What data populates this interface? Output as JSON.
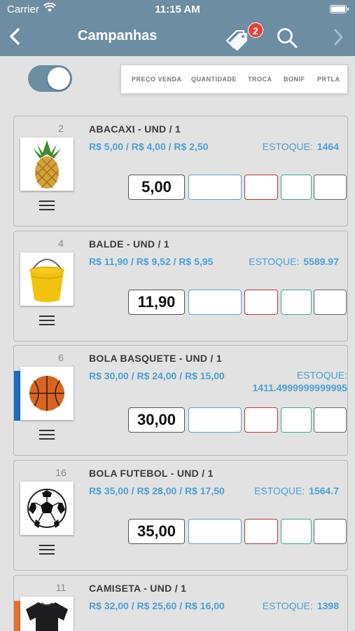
{
  "status": {
    "carrier": "Carrier",
    "time": "11:15 AM"
  },
  "nav": {
    "title": "Campanhas",
    "badge": "2"
  },
  "columns": {
    "preco": "PREÇO VENDA",
    "quantidade": "QUANTIDADE",
    "troca": "TROCA",
    "bonif": "BONIF",
    "prtla": "PRTLA"
  },
  "toggle": {
    "on": true
  },
  "stock_label": "ESTOQUE:",
  "products": [
    {
      "num": "2",
      "name": "ABACAXI - UND / 1",
      "prices": "R$ 5,00 / R$ 4,00 / R$ 2,50",
      "stock": "1464",
      "price_value": "5,00",
      "image": "pineapple",
      "stripe": ""
    },
    {
      "num": "4",
      "name": "BALDE - UND / 1",
      "prices": "R$ 11,90 / R$ 9,52 / R$ 5,95",
      "stock": "5589.97",
      "price_value": "11,90",
      "image": "bucket",
      "stripe": ""
    },
    {
      "num": "6",
      "name": "BOLA BASQUETE - UND / 1",
      "prices": "R$ 30,00 / R$ 24,00 / R$ 15,00",
      "stock": "1411.4999999999995",
      "price_value": "30,00",
      "image": "basketball",
      "stripe": "#1f6bbf"
    },
    {
      "num": "16",
      "name": "BOLA FUTEBOL - UND / 1",
      "prices": "R$ 35,00 / R$ 28,00 / R$ 17,50",
      "stock": "1564.7",
      "price_value": "35,00",
      "image": "soccer-ball",
      "stripe": ""
    },
    {
      "num": "11",
      "name": "CAMISETA - UND / 1",
      "prices": "R$ 32,00 / R$ 25,60 / R$ 16,00",
      "stock": "1398",
      "price_value": "",
      "image": "tshirt",
      "stripe": "#e0742a"
    }
  ]
}
